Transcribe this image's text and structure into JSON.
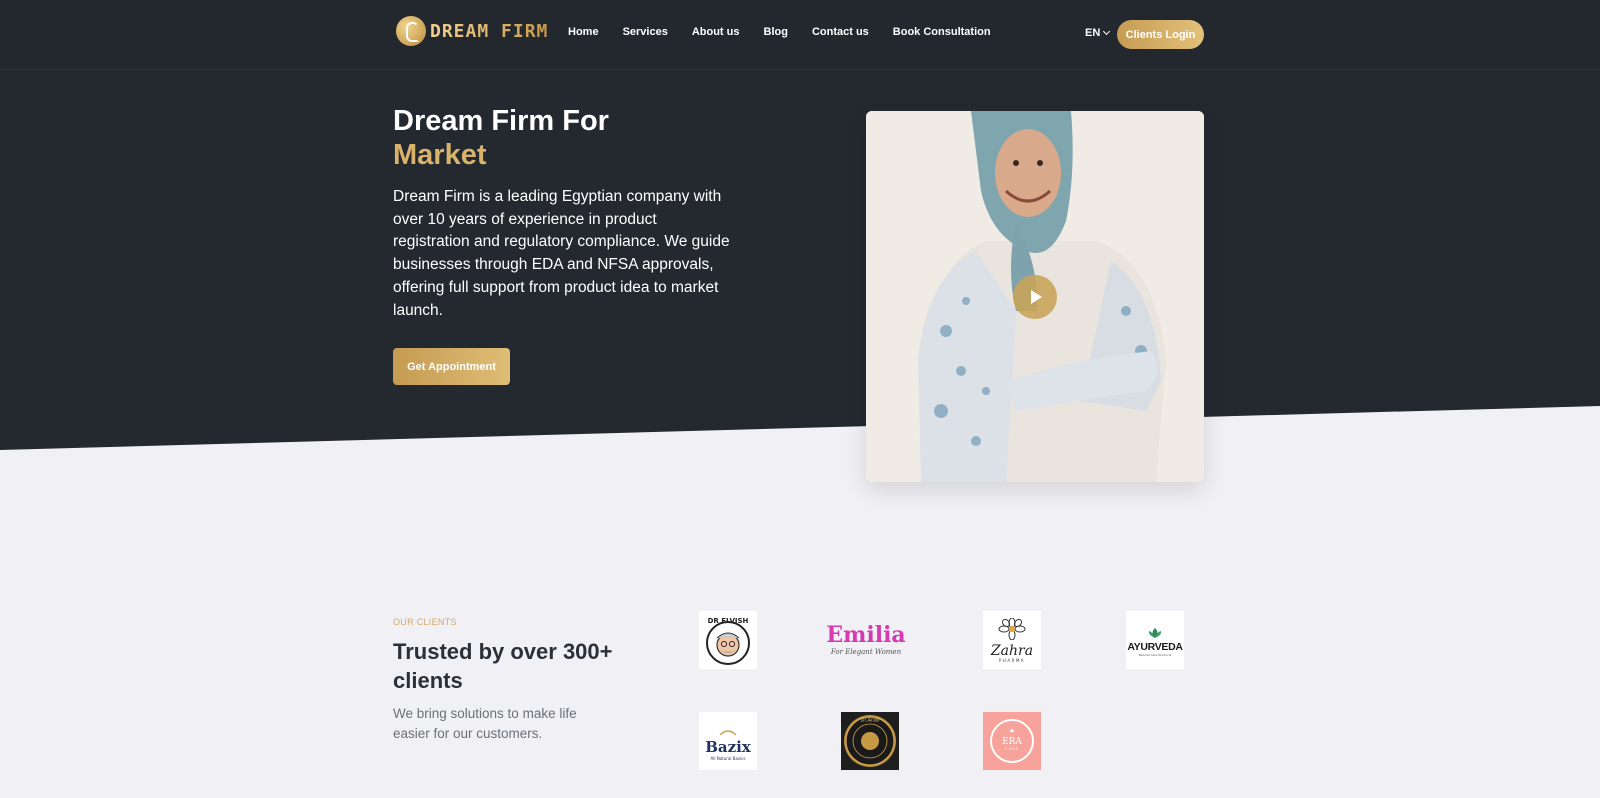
{
  "header": {
    "logo_text": "DREAM FIRM",
    "nav": [
      "Home",
      "Services",
      "About us",
      "Blog",
      "Contact us",
      "Book Consultation"
    ],
    "language": "EN",
    "login_label": "Clients Login"
  },
  "hero": {
    "title_line1": "Dream Firm For",
    "title_line2": "Market",
    "description": "Dream Firm is a leading Egyptian company with over 10 years of experience in product registration and regulatory compliance. We guide businesses through EDA and NFSA approvals, offering full support from product idea to market launch.",
    "cta_label": "Get Appointment"
  },
  "clients": {
    "eyebrow": "OUR CLIENTS",
    "title": "Trusted by over 300+ clients",
    "description": "We bring solutions to make life easier for our customers.",
    "logos": [
      {
        "name": "DR ELVISH"
      },
      {
        "name": "Emilia",
        "tagline": "For Elegant Women"
      },
      {
        "name": "Zahra",
        "tagline": "PHARMA"
      },
      {
        "name": "AYURVEDA",
        "tagline": "Natural Care Products"
      },
      {
        "name": "Bazix",
        "tagline": "All Natural Basics"
      },
      {
        "name": "Dr.Arab"
      },
      {
        "name": "ERA",
        "tagline": "CARE"
      }
    ]
  },
  "colors": {
    "dark": "#242930",
    "gold": "#d9b36b",
    "light": "#f0f0f5"
  }
}
